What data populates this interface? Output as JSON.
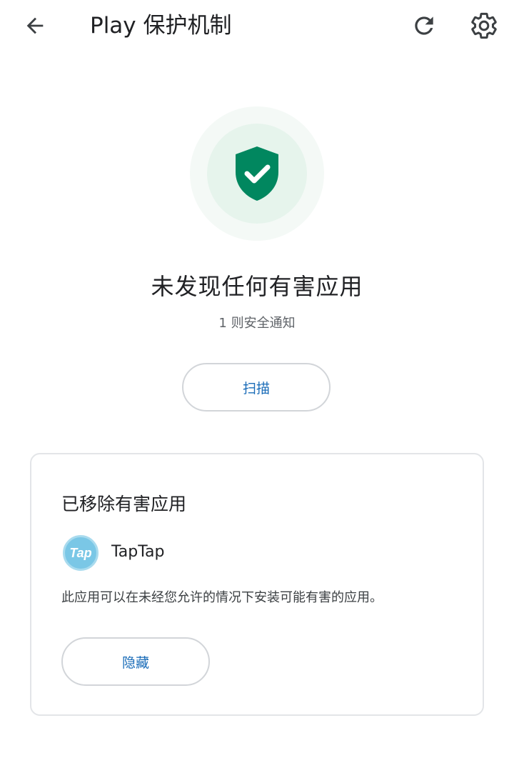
{
  "appbar": {
    "title": "Play 保护机制",
    "back_icon": "arrow-back-icon",
    "refresh_icon": "refresh-icon",
    "settings_icon": "gear-icon"
  },
  "status": {
    "icon": "shield-check-icon",
    "title": "未发现任何有害应用",
    "subtitle": "1 则安全通知",
    "scan_label": "扫描"
  },
  "card": {
    "title": "已移除有害应用",
    "app": {
      "icon_text": "Tap",
      "name": "TapTap"
    },
    "description": "此应用可以在未经您允许的情况下安装可能有害的应用。",
    "hide_label": "隐藏"
  },
  "colors": {
    "shield_green": "#01875f",
    "accent_blue": "#1a6cb8",
    "app_icon_bg": "#7ac7e6"
  }
}
